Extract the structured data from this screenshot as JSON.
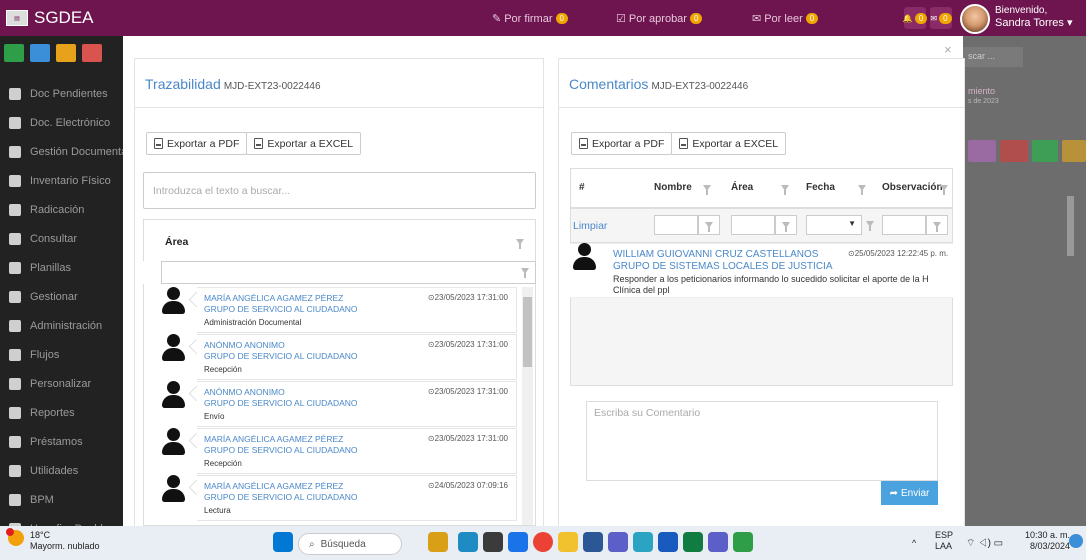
{
  "app": {
    "title": "SGDEA"
  },
  "topbar": {
    "items": [
      {
        "label": "Por firmar",
        "count": "0",
        "icon": "pen-icon"
      },
      {
        "label": "Por aprobar",
        "count": "0",
        "icon": "check-square-icon"
      },
      {
        "label": "Por leer",
        "count": "0",
        "icon": "envelope-icon"
      }
    ],
    "icon_counts": {
      "bell": "0",
      "mail": "0"
    },
    "welcome": "Bienvenido,",
    "user": "Sandra Torres"
  },
  "sidebar": {
    "items": [
      {
        "label": "Doc Pendientes",
        "icon": "inbox-icon"
      },
      {
        "label": "Doc. Electrónico",
        "icon": "at-icon"
      },
      {
        "label": "Gestión Documental",
        "icon": "documents-icon"
      },
      {
        "label": "Inventario Físico",
        "icon": "folder-open-icon"
      },
      {
        "label": "Radicación",
        "icon": "file-icon"
      },
      {
        "label": "Consultar",
        "icon": "search-icon"
      },
      {
        "label": "Planillas",
        "icon": "table-icon"
      },
      {
        "label": "Gestionar",
        "icon": "gavel-icon"
      },
      {
        "label": "Administración",
        "icon": "cogs-icon"
      },
      {
        "label": "Flujos",
        "icon": "sitemap-icon"
      },
      {
        "label": "Personalizar",
        "icon": "wrench-icon"
      },
      {
        "label": "Reportes",
        "icon": "printer-icon"
      },
      {
        "label": "Préstamos",
        "icon": "hand-icon"
      },
      {
        "label": "Utilidades",
        "icon": "briefcase-icon"
      },
      {
        "label": "BPM",
        "icon": "sitemap-icon"
      },
      {
        "label": "Hangfire Dashboard",
        "icon": "users-icon"
      }
    ]
  },
  "background_right": {
    "search_placeholder": "scar ...",
    "heading": "miento",
    "date_fragment": "s de 2023"
  },
  "trazabilidad": {
    "title": "Trazabilidad",
    "code": "MJD-EXT23-0022446",
    "export_pdf": "Exportar a PDF",
    "export_excel": "Exportar a EXCEL",
    "search_placeholder": "Introduzca el texto a buscar...",
    "column": "Área",
    "entries": [
      {
        "name": "MARÍA ANGÉLICA AGAMEZ PÉREZ",
        "group": "GRUPO DE SERVICIO AL CIUDADANO",
        "step": "Administración Documental",
        "date": "23/05/2023 17:31:00"
      },
      {
        "name": "ANÓNMO ANONIMO",
        "group": "GRUPO DE SERVICIO AL CIUDADANO",
        "step": "Recepción",
        "date": "23/05/2023 17:31:00"
      },
      {
        "name": "ANÓNMO ANONIMO",
        "group": "GRUPO DE SERVICIO AL CIUDADANO",
        "step": "Envío",
        "date": "23/05/2023 17:31:00"
      },
      {
        "name": "MARÍA ANGÉLICA AGAMEZ PÉREZ",
        "group": "GRUPO DE SERVICIO AL CIUDADANO",
        "step": "Recepción",
        "date": "23/05/2023 17:31:00"
      },
      {
        "name": "MARÍA ANGÉLICA AGAMEZ PÉREZ",
        "group": "GRUPO DE SERVICIO AL CIUDADANO",
        "step": "Lectura",
        "date": "24/05/2023 07:09:16"
      }
    ]
  },
  "comentarios": {
    "title": "Comentarios",
    "code": "MJD-EXT23-0022446",
    "export_pdf": "Exportar a PDF",
    "export_excel": "Exportar a EXCEL",
    "columns": [
      "#",
      "Nombre",
      "Área",
      "Fecha",
      "Observación"
    ],
    "clear_label": "Limpiar",
    "comment": {
      "name": "WILLIAM GUIOVANNI CRUZ CASTELLANOS",
      "group": "GRUPO DE SISTEMAS LOCALES DE JUSTICIA",
      "text": "Responder a los peticionarios informando lo sucedido solicitar el aporte de la H Clínica del ppl",
      "date": "25/05/2023 12:22:45 p. m."
    },
    "textarea_placeholder": "Escriba su Comentario",
    "send_label": "Enviar"
  },
  "taskbar": {
    "weather_temp": "18°C",
    "weather_desc": "Mayorm. nublado",
    "search": "Búsqueda",
    "lang_top": "ESP",
    "lang_bottom": "LAA",
    "time": "10:30 a. m.",
    "date": "8/03/2024"
  },
  "colors": {
    "topbar": "#6e1550",
    "link": "#4a88c9",
    "send": "#4aa3df",
    "badge": "#f0a500"
  }
}
